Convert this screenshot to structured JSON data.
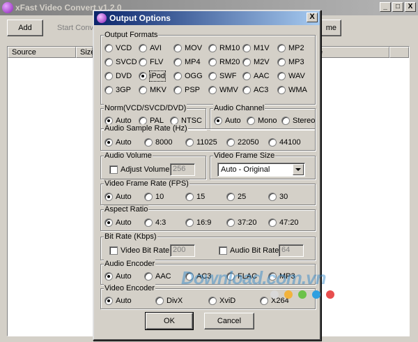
{
  "main": {
    "title": "xFast Video Convert v1.2.0",
    "toolbar": {
      "add": "Add",
      "start": "Start Conv",
      "home": "me"
    },
    "list_columns": [
      "Source",
      "Size",
      "e"
    ],
    "window_buttons": [
      "_",
      "□",
      "X"
    ]
  },
  "dialog": {
    "title": "Output Options",
    "close": "X",
    "output_formats": {
      "label": "Output Formats",
      "selected": "iPod",
      "options": [
        "VCD",
        "AVI",
        "MOV",
        "RM10",
        "M1V",
        "MP2",
        "SVCD",
        "FLV",
        "MP4",
        "RM20",
        "M2V",
        "MP3",
        "DVD",
        "iPod",
        "OGG",
        "SWF",
        "AAC",
        "WAV",
        "3GP",
        "MKV",
        "PSP",
        "WMV",
        "AC3",
        "WMA"
      ]
    },
    "norm": {
      "label": "Norm(VCD/SVCD/DVD)",
      "selected": "Auto",
      "options": [
        "Auto",
        "PAL",
        "NTSC"
      ]
    },
    "audio_channel": {
      "label": "Audio Channel",
      "selected": "Auto",
      "options": [
        "Auto",
        "Mono",
        "Stereo"
      ]
    },
    "audio_sample_rate": {
      "label": "Audio Sample Rate (Hz)",
      "selected": "Auto",
      "options": [
        "Auto",
        "8000",
        "11025",
        "22050",
        "44100"
      ]
    },
    "audio_volume": {
      "label": "Audio Volume",
      "checkbox": "Adjust Volume",
      "value": "256",
      "checked": false
    },
    "video_frame_size": {
      "label": "Video Frame Size",
      "value": "Auto - Original"
    },
    "video_frame_rate": {
      "label": "Video Frame Rate (FPS)",
      "selected": "Auto",
      "options": [
        "Auto",
        "10",
        "15",
        "25",
        "30"
      ]
    },
    "aspect_ratio": {
      "label": "Aspect Ratio",
      "selected": "Auto",
      "options": [
        "Auto",
        "4:3",
        "16:9",
        "37:20",
        "47:20"
      ]
    },
    "bit_rate": {
      "label": "Bit Rate (Kbps)",
      "video_checkbox": "Video Bit Rate",
      "video_value": "200",
      "audio_checkbox": "Audio Bit Rate",
      "audio_value": "64"
    },
    "audio_encoder": {
      "label": "Audio Encoder",
      "selected": "Auto",
      "options": [
        "Auto",
        "AAC",
        "AC3",
        "FLAC",
        "MP3"
      ]
    },
    "video_encoder": {
      "label": "Video Encoder",
      "selected": "Auto",
      "options": [
        "Auto",
        "DivX",
        "XviD",
        "X264"
      ]
    },
    "ok": "OK",
    "cancel": "Cancel"
  },
  "watermark": {
    "text": "Download.com.vn",
    "dot_colors": [
      "#d9d9d9",
      "#f2b33d",
      "#6cc24a",
      "#2f9fe0",
      "#e84e4e"
    ]
  }
}
